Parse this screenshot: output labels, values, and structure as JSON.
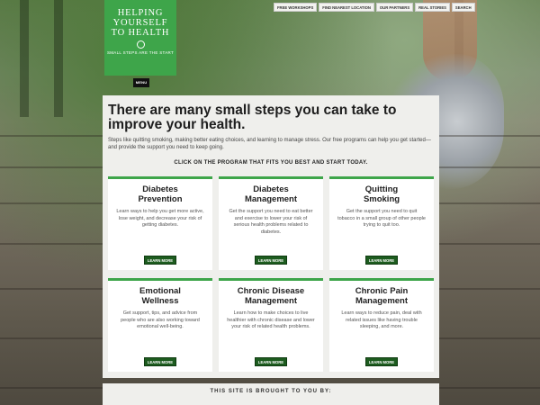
{
  "logo": {
    "line1": "HELPING",
    "line2": "YOURSELF",
    "line3": "TO HEALTH",
    "tagline": "SMALL STEPS ARE THE START"
  },
  "menu_label": "MENU",
  "topnav": [
    "FREE WORKSHOPS",
    "FIND NEAREST LOCATION",
    "OUR PARTNERS",
    "REAL STORIES",
    "SEARCH"
  ],
  "main": {
    "headline": "There are many small steps you can take to improve your health.",
    "intro": "Steps like quitting smoking, making better eating choices, and learning to manage stress. Our free programs can help you get started—and provide the support you need to keep going.",
    "cta": "CLICK ON THE PROGRAM THAT FITS YOU BEST AND START TODAY."
  },
  "programs": [
    {
      "title": "Diabetes Prevention",
      "desc": "Learn ways to help you get more active, lose weight, and decrease your risk of getting diabetes.",
      "button": "LEARN MORE"
    },
    {
      "title": "Diabetes Management",
      "desc": "Get the support you need to eat better and exercise to lower your risk of serious health problems related to diabetes.",
      "button": "LEARN MORE"
    },
    {
      "title": "Quitting Smoking",
      "desc": "Get the support you need to quit tobacco in a small group of other people trying to quit too.",
      "button": "LEARN MORE"
    },
    {
      "title": "Emotional Wellness",
      "desc": "Get support, tips, and advice from people who are also working toward emotional well-being.",
      "button": "LEARN MORE"
    },
    {
      "title": "Chronic Disease Management",
      "desc": "Learn how to make choices to live healthier with chronic disease and lower your risk of related health problems.",
      "button": "LEARN MORE"
    },
    {
      "title": "Chronic Pain Management",
      "desc": "Learn ways to reduce pain, deal with related issues like having trouble sleeping, and more.",
      "button": "LEARN MORE"
    }
  ],
  "footer": {
    "brought_by": "THIS SITE IS BROUGHT TO YOU BY:"
  },
  "colors": {
    "brand_green": "#3ea54a",
    "button_green": "#1d5c1f",
    "panel_bg": "#efefec"
  }
}
